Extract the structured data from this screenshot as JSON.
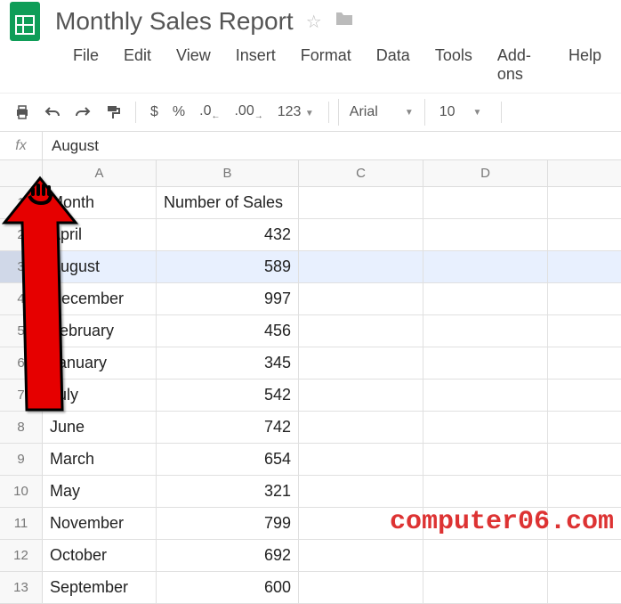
{
  "header": {
    "title": "Monthly Sales Report"
  },
  "menu": [
    "File",
    "Edit",
    "View",
    "Insert",
    "Format",
    "Data",
    "Tools",
    "Add-ons",
    "Help"
  ],
  "toolbar": {
    "currency": "$",
    "percent": "%",
    "dec_dec": ".0",
    "inc_dec": ".00",
    "more_formats": "123",
    "font": "Arial",
    "font_size": "10"
  },
  "formula_bar": {
    "label": "fx",
    "value": "August"
  },
  "columns": [
    "A",
    "B",
    "C",
    "D"
  ],
  "selected_row_index": 2,
  "rows": [
    {
      "n": "1",
      "a": "Month",
      "b": "Number of Sales",
      "b_num": false
    },
    {
      "n": "2",
      "a": "April",
      "b": "432",
      "b_num": true
    },
    {
      "n": "3",
      "a": "August",
      "b": "589",
      "b_num": true
    },
    {
      "n": "4",
      "a": "December",
      "b": "997",
      "b_num": true
    },
    {
      "n": "5",
      "a": "February",
      "b": "456",
      "b_num": true
    },
    {
      "n": "6",
      "a": "January",
      "b": "345",
      "b_num": true
    },
    {
      "n": "7",
      "a": "July",
      "b": "542",
      "b_num": true
    },
    {
      "n": "8",
      "a": "June",
      "b": "742",
      "b_num": true
    },
    {
      "n": "9",
      "a": "March",
      "b": "654",
      "b_num": true
    },
    {
      "n": "10",
      "a": "May",
      "b": "321",
      "b_num": true
    },
    {
      "n": "11",
      "a": "November",
      "b": "799",
      "b_num": true
    },
    {
      "n": "12",
      "a": "October",
      "b": "692",
      "b_num": true
    },
    {
      "n": "13",
      "a": "September",
      "b": "600",
      "b_num": true
    }
  ],
  "watermark": "computer06.com"
}
